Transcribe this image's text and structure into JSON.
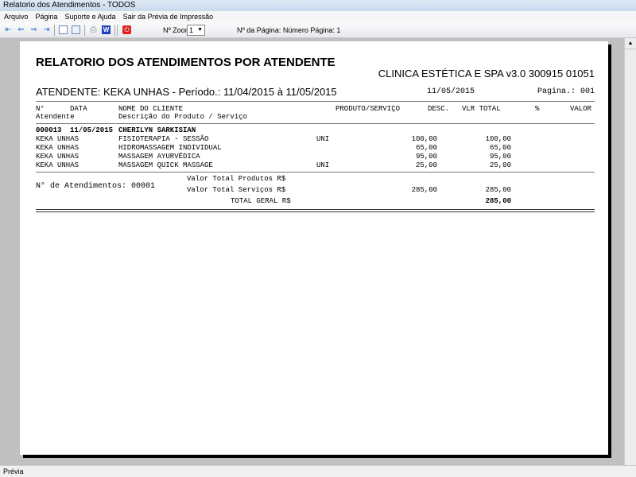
{
  "window": {
    "title": "Relatorio dos Atendimentos - TODOS"
  },
  "menu": [
    "Arquivo",
    "Página",
    "Suporte e Ajuda",
    "Sair da Prévia de Impressão"
  ],
  "toolbar": {
    "zoom_label": "Nº Zoom",
    "zoom_value": "1",
    "page_info": "Nº da Página: Número Página: 1"
  },
  "report": {
    "title": "RELATORIO DOS ATENDIMENTOS POR ATENDENTE",
    "company": "CLINICA ESTÉTICA E SPA v3.0 300915 01051",
    "attendant_line": "ATENDENTE: KEKA UNHAS -  Período.: 11/04/2015 à 11/05/2015",
    "date": "11/05/2015",
    "page": "Pagina.: 001",
    "headers": {
      "num": "N°",
      "date": "DATA",
      "client": "NOME DO CLIENTE",
      "prod": "PRODUTO/SERVIÇO",
      "desc": "DESC.",
      "total": "VLR TOTAL",
      "pct": "%",
      "valor": "VALOR",
      "attendant": "Atendente",
      "description": "Descrição do Produto / Serviço"
    },
    "record": {
      "num": "000013",
      "date": "11/05/2015",
      "client": "CHERILYN SARKISIAN"
    },
    "items": [
      {
        "attendant": "KEKA UNHAS",
        "description": "FISIOTERAPIA - SESSÃO",
        "unit": "UNI",
        "value": "100,00",
        "total": "100,00"
      },
      {
        "attendant": "KEKA UNHAS",
        "description": "HIDROMASSAGEM INDIVIDUAL",
        "unit": "",
        "value": "65,00",
        "total": "65,00"
      },
      {
        "attendant": "KEKA UNHAS",
        "description": "MASSAGEM AYURVÉDICA",
        "unit": "",
        "value": "95,00",
        "total": "95,00"
      },
      {
        "attendant": "KEKA UNHAS",
        "description": "MASSAGEM QUICK MASSAGE",
        "unit": "UNI",
        "value": "25,00",
        "total": "25,00"
      }
    ],
    "summary": {
      "count_label": "N° de Atendimentos: 00001",
      "products_label": "Valor Total Produtos R$",
      "services_label": "Valor Total Serviços R$",
      "services_value": "285,00",
      "services_total": "285,00",
      "grand_label": "TOTAL GERAL R$",
      "grand_total": "285,00"
    }
  },
  "status": "Prévia"
}
